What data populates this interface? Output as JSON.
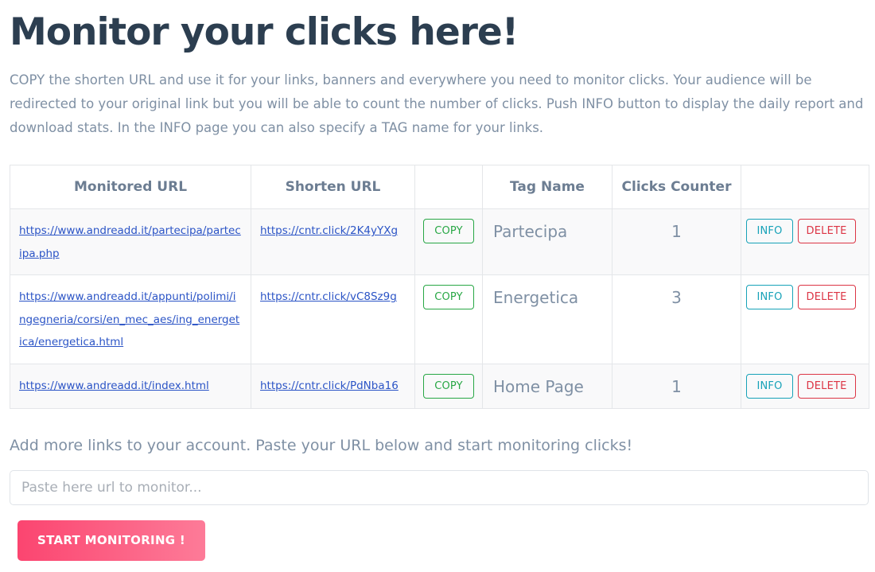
{
  "header": {
    "title": "Monitor your clicks here!",
    "intro": "COPY the shorten URL and use it for your links, banners and everywhere you need to monitor clicks. Your audience will be redirected to your original link but you will be able to count the number of clicks. Push INFO button to display the daily report and download stats. In the INFO page you can also specify a TAG name for your links."
  },
  "table": {
    "columns": [
      {
        "label": "Monitored URL"
      },
      {
        "label": "Shorten URL"
      },
      {
        "label": ""
      },
      {
        "label": "Tag Name"
      },
      {
        "label": "Clicks Counter"
      },
      {
        "label": ""
      }
    ],
    "copy_label": "COPY",
    "info_label": "INFO",
    "delete_label": "DELETE",
    "rows": [
      {
        "monitored_url": "https://www.andreadd.it/partecipa/partecipa.php",
        "shorten_url": "https://cntr.click/2K4yYXg",
        "tag_name": "Partecipa",
        "clicks_counter": "1"
      },
      {
        "monitored_url": "https://www.andreadd.it/appunti/polimi/ingegneria/corsi/en_mec_aes/ing_energetica/energetica.html",
        "shorten_url": "https://cntr.click/vC8Sz9g",
        "tag_name": "Energetica",
        "clicks_counter": "3"
      },
      {
        "monitored_url": "https://www.andreadd.it/index.html",
        "shorten_url": "https://cntr.click/PdNba16",
        "tag_name": "Home Page",
        "clicks_counter": "1"
      }
    ]
  },
  "add_form": {
    "label": "Add more links to your account. Paste your URL below and start monitoring clicks!",
    "input_value": "",
    "input_placeholder": "Paste here url to monitor...",
    "submit_label": "START MONITORING !"
  },
  "colors": {
    "title": "#2c3e50",
    "muted_text": "#7f90a4",
    "link": "#2b54c6",
    "copy_green": "#28a745",
    "info_cyan": "#17a2b8",
    "delete_red": "#dc3545",
    "button_pink_start": "#fb4570",
    "button_pink_end": "#fd7b98",
    "row_stripe": "#f9f9fa",
    "border": "#e4e6e9"
  }
}
